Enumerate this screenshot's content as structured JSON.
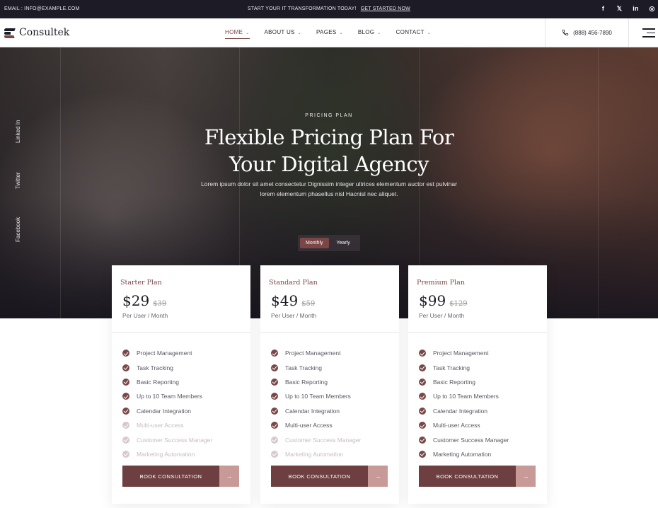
{
  "topbar": {
    "email": "EMAIL : INFO@EXAMPLE.COM",
    "promo_text": "START YOUR IT TRANSFORMATION TODAY!",
    "promo_link": "GET STARTED NOW",
    "social": [
      {
        "icon": "facebook-icon",
        "glyph": "f"
      },
      {
        "icon": "x-twitter-icon",
        "glyph": "𝕏"
      },
      {
        "icon": "linkedin-icon",
        "glyph": "in"
      },
      {
        "icon": "instagram-icon",
        "glyph": "◎"
      }
    ]
  },
  "nav": {
    "logo": "Consultek",
    "menu": [
      {
        "label": "HOME",
        "active": true
      },
      {
        "label": "ABOUT US",
        "active": false
      },
      {
        "label": "PAGES",
        "active": false
      },
      {
        "label": "BLOG",
        "active": false
      },
      {
        "label": "CONTACT",
        "active": false
      }
    ],
    "phone": "(888) 456-7890"
  },
  "hero": {
    "eyebrow": "PRICING PLAN",
    "title_line1": "Flexible Pricing Plan For",
    "title_line2": "Your Digital Agency",
    "description": "Lorem ipsum dolor sit amet consectetur Dignissim integer ultrices elementum auctor est pulvinar lorem elementum phasellus nisl Hacnisl nec aliquet.",
    "social_vertical": [
      "Linked In",
      "Twitter",
      "Facebook"
    ],
    "toggle": {
      "monthly": "Monthly",
      "yearly": "Yearly",
      "selected": "Monthly"
    }
  },
  "plans": [
    {
      "name": "Starter Plan",
      "price": "$29",
      "old_price": "$39",
      "period": "Per User / Month",
      "features": [
        {
          "label": "Project Management",
          "included": true
        },
        {
          "label": "Task Tracking",
          "included": true
        },
        {
          "label": "Basic Reporting",
          "included": true
        },
        {
          "label": "Up to 10 Team Members",
          "included": true
        },
        {
          "label": "Calendar Integration",
          "included": true
        },
        {
          "label": "Multi-user Access",
          "included": false
        },
        {
          "label": "Customer Success Manager",
          "included": false
        },
        {
          "label": "Marketing Automation",
          "included": false
        }
      ],
      "button": "BOOK CONSULTATION"
    },
    {
      "name": "Standard Plan",
      "price": "$49",
      "old_price": "$59",
      "period": "Per User / Month",
      "features": [
        {
          "label": "Project Management",
          "included": true
        },
        {
          "label": "Task Tracking",
          "included": true
        },
        {
          "label": "Basic Reporting",
          "included": true
        },
        {
          "label": "Up to 10 Team Members",
          "included": true
        },
        {
          "label": "Calendar Integration",
          "included": true
        },
        {
          "label": "Multi-user Access",
          "included": true
        },
        {
          "label": "Customer Success Manager",
          "included": false
        },
        {
          "label": "Marketing Automation",
          "included": false
        }
      ],
      "button": "BOOK CONSULTATION"
    },
    {
      "name": "Premium Plan",
      "price": "$99",
      "old_price": "$129",
      "period": "Per User / Month",
      "features": [
        {
          "label": "Project Management",
          "included": true
        },
        {
          "label": "Task Tracking",
          "included": true
        },
        {
          "label": "Basic Reporting",
          "included": true
        },
        {
          "label": "Up to 10 Team Members",
          "included": true
        },
        {
          "label": "Calendar Integration",
          "included": true
        },
        {
          "label": "Multi-user Access",
          "included": true
        },
        {
          "label": "Customer Success Manager",
          "included": true
        },
        {
          "label": "Marketing Automation",
          "included": true
        }
      ],
      "button": "BOOK CONSULTATION"
    }
  ],
  "colors": {
    "accent": "#7a4646",
    "dark": "#1d1b26",
    "muted_check": "#d8c8ca",
    "button_arrow": "#c79a98"
  }
}
